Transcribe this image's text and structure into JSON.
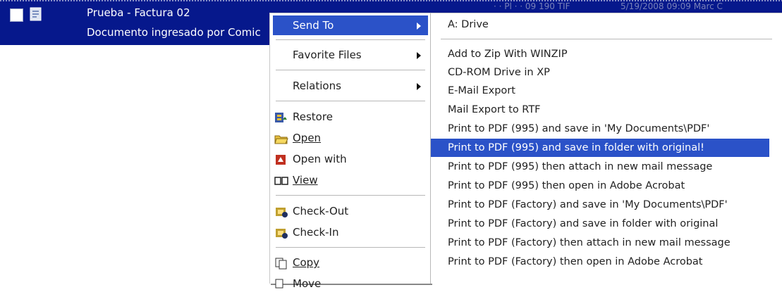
{
  "file_row": {
    "name": "Prueba - Factura 02",
    "description": "Documento ingresado por Comic",
    "faint_col1": "· · Pl · · 09 190 TIF",
    "faint_col2": "5/19/2008  09:09 Marc C"
  },
  "context_menu": {
    "send_to": "Send To",
    "favorite_files": "Favorite Files",
    "relations": "Relations",
    "restore": "Restore",
    "open": "Open",
    "open_with": "Open with",
    "view": "View",
    "check_out": "Check-Out",
    "check_in": "Check-In",
    "copy": "Copy",
    "move": "Move"
  },
  "send_to_submenu": {
    "items": [
      "A: Drive",
      "Add to Zip With WINZIP",
      "CD-ROM Drive in XP",
      "E-Mail Export",
      "Mail Export to RTF",
      "Print to PDF (995) and save in 'My Documents\\PDF'",
      "Print to PDF (995) and save in folder with original!",
      "Print to PDF (995) then attach in new mail message",
      "Print to PDF (995) then open in Adobe Acrobat",
      "Print to PDF (Factory) and save in 'My Documents\\PDF'",
      "Print to PDF (Factory) and save in folder with original",
      "Print to PDF (Factory) then attach in new mail message",
      "Print to PDF (Factory) then open in Adobe Acrobat"
    ],
    "selected_index": 6
  },
  "colors": {
    "row_selected": "#06188c",
    "menu_highlight": "#2b52c8"
  }
}
